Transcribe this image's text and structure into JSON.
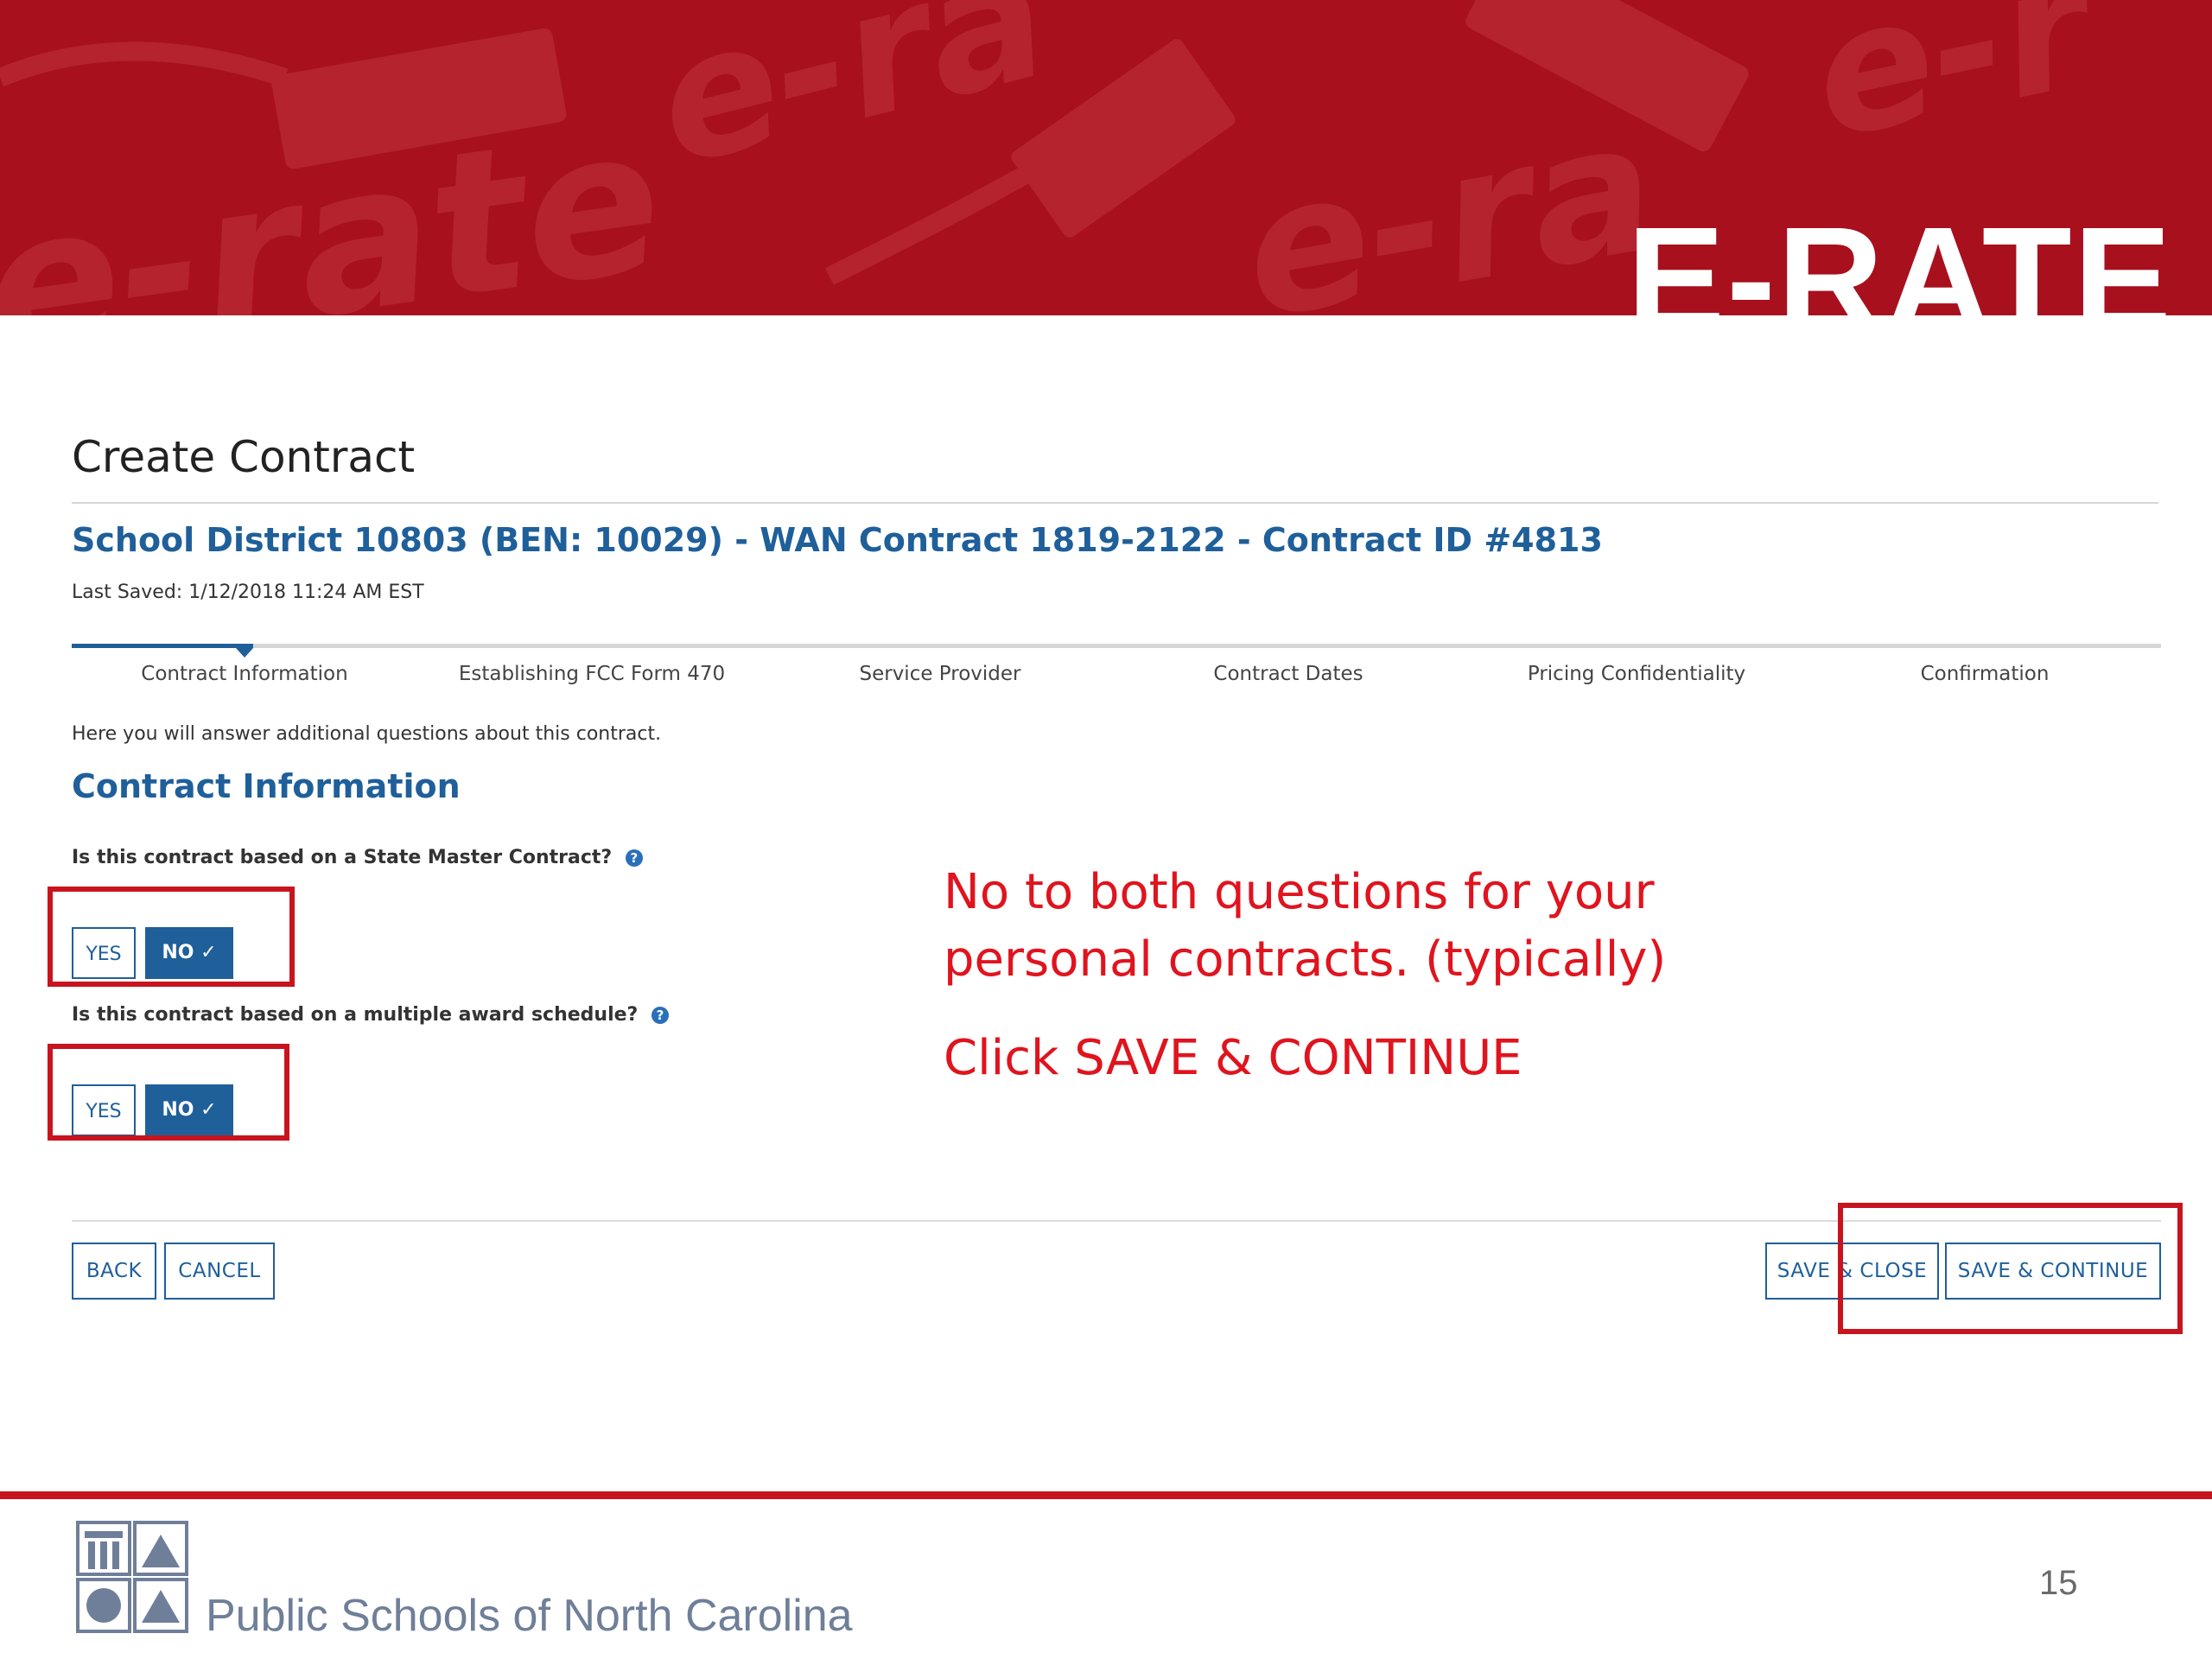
{
  "banner": {
    "title": "E-RATE",
    "bg_words": [
      "e-rate",
      "e-ra",
      "e-ra",
      "e-r"
    ]
  },
  "page": {
    "title": "Create Contract",
    "contract_heading": "School District 10803 (BEN: 10029) - WAN Contract 1819-2122 - Contract ID #4813",
    "last_saved": "Last Saved: 1/12/2018 11:24 AM EST"
  },
  "stepper": {
    "steps": [
      {
        "label": "Contract Information"
      },
      {
        "label": "Establishing FCC Form 470"
      },
      {
        "label": "Service Provider"
      },
      {
        "label": "Contract Dates"
      },
      {
        "label": "Pricing Confidentiality"
      },
      {
        "label": "Confirmation"
      }
    ],
    "current_step": 1
  },
  "form": {
    "intro": "Here you will answer additional questions about this contract.",
    "section_heading": "Contract Information",
    "questions": [
      {
        "text": "Is this contract based on a State Master Contract?",
        "yes_label": "YES",
        "no_label": "NO ✓",
        "selected": "NO"
      },
      {
        "text": "Is this contract based on a multiple award schedule?",
        "yes_label": "YES",
        "no_label": "NO ✓",
        "selected": "NO"
      }
    ],
    "help_glyph": "?"
  },
  "annotation": {
    "line1": "No to both questions for your",
    "line2": "personal contracts. (typically)",
    "line3": "Click SAVE & CONTINUE"
  },
  "actions": {
    "back": "BACK",
    "cancel": "CANCEL",
    "save_close": "SAVE & CLOSE",
    "save_continue": "SAVE & CONTINUE"
  },
  "footer": {
    "org": "Public Schools of North Carolina",
    "page_number": "15"
  },
  "colors": {
    "banner_red": "#a8101e",
    "primary_blue": "#1f5f9a",
    "annotation_red": "#e0141e",
    "highlight_red": "#c8141e"
  }
}
